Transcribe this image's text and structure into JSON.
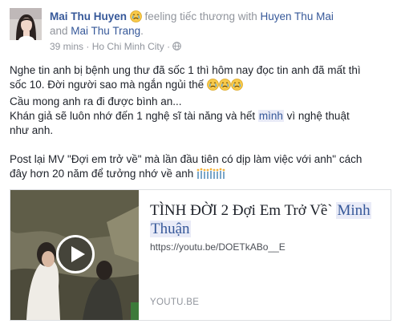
{
  "post": {
    "author": "Mai Thu Huyen",
    "feeling_prefix": "feeling tiếc thương with",
    "tag1": "Huyen Thu Mai",
    "and_text": "and",
    "tag2": "Mai Thu Trang",
    "period": ".",
    "time": "39 mins",
    "separator": "·",
    "location": "Ho Chi Minh City",
    "separator2": "·",
    "icons": {
      "feeling": "crying-emoji-icon",
      "privacy": "globe-icon"
    },
    "lines": {
      "l1": "Nghe tin anh bị bệnh ung thư đã sốc 1 thì hôm nay đọc tin anh đã mất thì",
      "l2": "sốc 10. Đời người sao mà ngắn ngủi thế",
      "l3": "Cầu mong anh ra đi được bình an...",
      "l4a": "Khán giả sẽ luôn nhớ đến 1 nghệ sĩ tài năng và hết",
      "l4b": "mình",
      "l4c": "vì nghệ thuật",
      "l5": "như anh.",
      "l6": "Post lại MV \"Đợi em trở về\" mà lần đầu tiên có dịp làm việc với anh\" cách",
      "l7": "đây hơn 20 năm để tưởng nhớ về anh"
    }
  },
  "link_card": {
    "title_a": "TÌNH ĐỜI 2 Đợi Em Trở Về`",
    "title_b": "Minh",
    "title_c": "Thuận",
    "url": "https://youtu.be/DOETkABo__E",
    "domain": "YOUTU.BE",
    "icons": {
      "play": "play-icon"
    }
  },
  "colors": {
    "link": "#365899",
    "muted": "#90949c",
    "text": "#1d2129"
  }
}
